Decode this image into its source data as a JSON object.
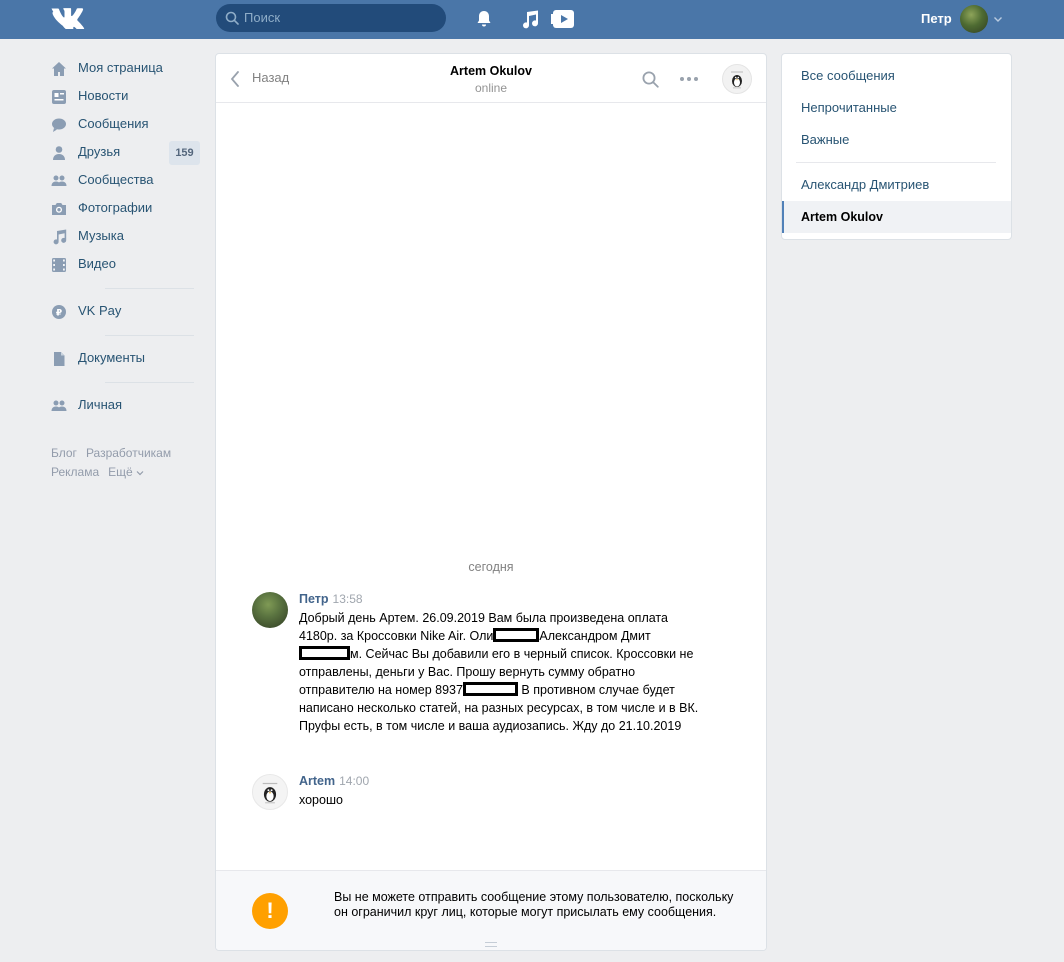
{
  "topbar": {
    "search_placeholder": "Поиск",
    "user_name": "Петр"
  },
  "sidebar": {
    "items": [
      {
        "label": "Моя страница",
        "icon": "home-icon"
      },
      {
        "label": "Новости",
        "icon": "news-icon"
      },
      {
        "label": "Сообщения",
        "icon": "messages-icon"
      },
      {
        "label": "Друзья",
        "icon": "friends-icon",
        "badge": "159"
      },
      {
        "label": "Сообщества",
        "icon": "groups-icon"
      },
      {
        "label": "Фотографии",
        "icon": "camera-icon"
      },
      {
        "label": "Музыка",
        "icon": "music-icon"
      },
      {
        "label": "Видео",
        "icon": "video-icon"
      },
      {
        "label": "VK Pay",
        "icon": "vkpay-icon"
      },
      {
        "label": "Документы",
        "icon": "documents-icon"
      },
      {
        "label": "Личная",
        "icon": "group-icon"
      }
    ],
    "footer": [
      "Блог",
      "Разработчикам",
      "Реклама",
      "Ещё"
    ]
  },
  "chat": {
    "back_label": "Назад",
    "peer_name": "Artem Okulov",
    "peer_status": "online",
    "day_label": "сегодня",
    "messages": [
      {
        "author": "Петр",
        "time": "13:58",
        "parts": [
          "Добрый день Артем. 26.09.2019 Вам была произведена оплата 4180р. за Кроссовки Nike Air. Оли",
          "Александром Дмит",
          "м. Сейчас Вы добавили его в черный список. Кроссовки не отправлены, деньги у Вас. Прошу вернуть сумму обратно отправителю на номер 8937",
          " В противном случае будет написано несколько статей, на разных ресурсах, в том числе и в ВК. Пруфы есть, в том числе и ваша аудиозапись. Жду до 21.10.2019"
        ]
      },
      {
        "author": "Artem",
        "time": "14:00",
        "text": "хорошо"
      }
    ],
    "notice": "Вы не можете отправить сообщение этому пользователю, поскольку он ограничил круг лиц, которые могут присылать ему сообщения."
  },
  "right_panel": {
    "filters": [
      "Все сообщения",
      "Непрочитанные",
      "Важные"
    ],
    "conversations": [
      "Александр Дмитриев",
      "Artem Okulov"
    ]
  },
  "colors": {
    "header": "#4a76a8",
    "link": "#285473",
    "author": "#42648b",
    "warning": "#ffa000"
  }
}
